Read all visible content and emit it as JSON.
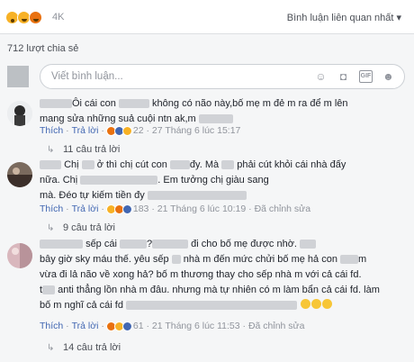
{
  "reactions": {
    "count": "4K",
    "related_label": "Bình luận liên quan nhất ▾"
  },
  "shares": "712 lượt chia sẻ",
  "comment_box": {
    "placeholder": "Viết bình luận..."
  },
  "comments": [
    {
      "text_parts": [
        "Ôi cái con",
        "không có não này,bố mẹ m đẻ m ra để m lên",
        "mang sửa những suả cuội ntn ak,m"
      ],
      "like": "Thích",
      "reply": "Trả lời",
      "reaction_count": "22",
      "timestamp": "27 Tháng 6 lúc 15:17",
      "edited": "",
      "replies": "11 câu trả lời"
    },
    {
      "text_parts": [
        "Chị",
        "ở thì chị cút con",
        "đy. Mà",
        "phải cút khỏi cái nhà đấy",
        "nữa. Chị",
        ". Em tưởng chị giàu sang",
        "mà. Đéo tự kiếm tiền đy"
      ],
      "like": "Thích",
      "reply": "Trả lời",
      "reaction_count": "183",
      "timestamp": "21 Tháng 6 lúc 10:19",
      "edited": "Đã chỉnh sửa",
      "replies": "9 câu trả lời"
    },
    {
      "text_parts": [
        "sếp cái",
        "?",
        "đi cho bố mẹ được nhờ.",
        "bây giờ sky máu thế. yêu sếp",
        "nhà m đến mức chửi bố mẹ hả con",
        "m",
        "vừa đi lả não về xong hả? bố m thương thay cho sếp nhà m với cả cái fd.",
        "t",
        "anti thẳng lồn nhà m đâu. nhưng mà tự nhiên có m làm bẩn cả cái fd. làm",
        "bố m nghĩ cả cái fd"
      ],
      "like": "Thích",
      "reply": "Trả lời",
      "reaction_count": "61",
      "timestamp": "21 Tháng 6 lúc 11:53",
      "edited": "Đã chỉnh sửa",
      "replies": "14 câu trả lời"
    }
  ],
  "colors": {
    "link": "#4267b2",
    "meta": "#90949c",
    "haha": "#f7b125",
    "angry": "#e9710f"
  }
}
